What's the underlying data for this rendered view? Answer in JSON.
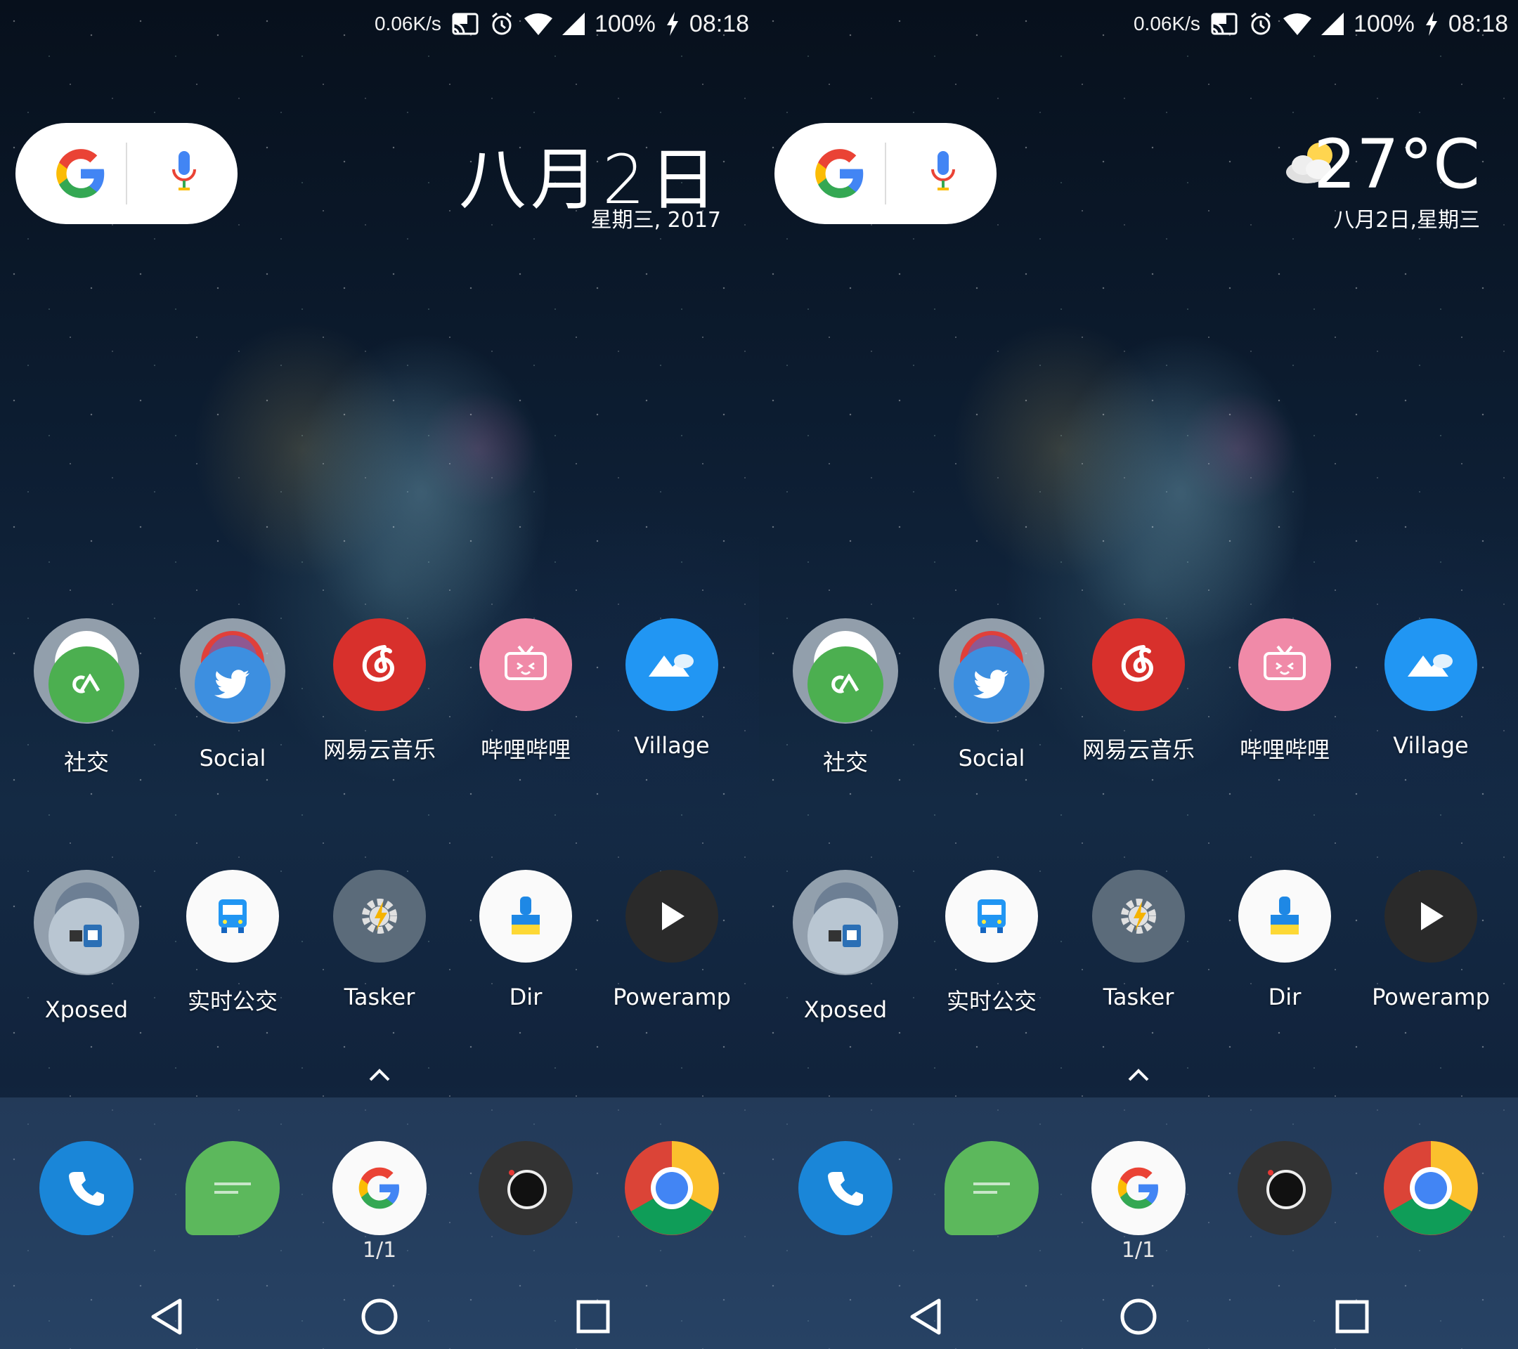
{
  "status": {
    "speed": "0.06K/s",
    "battery": "100%",
    "time": "08:18"
  },
  "left": {
    "date_big": "八月2日",
    "date_small": "星期三, 2017"
  },
  "right": {
    "temperature": "27°C",
    "date_small": "八月2日,星期三"
  },
  "apps_row1": [
    {
      "label": "社交"
    },
    {
      "label": "Social"
    },
    {
      "label": "网易云音乐"
    },
    {
      "label": "哔哩哔哩"
    },
    {
      "label": "Village"
    }
  ],
  "apps_row2": [
    {
      "label": "Xposed"
    },
    {
      "label": "实时公交"
    },
    {
      "label": "Tasker"
    },
    {
      "label": "Dir"
    },
    {
      "label": "Poweramp"
    }
  ],
  "dock": {
    "page_indicator": "1/1",
    "items": [
      "phone-icon",
      "messages-icon",
      "google-icon",
      "camera-icon",
      "chrome-icon"
    ]
  },
  "colors": {
    "music_red": "#d8302c",
    "bilibili_pink": "#f08aa8",
    "village_blue": "#2196f3",
    "phone_blue": "#1a86d8",
    "messages_green": "#5cb85c"
  }
}
